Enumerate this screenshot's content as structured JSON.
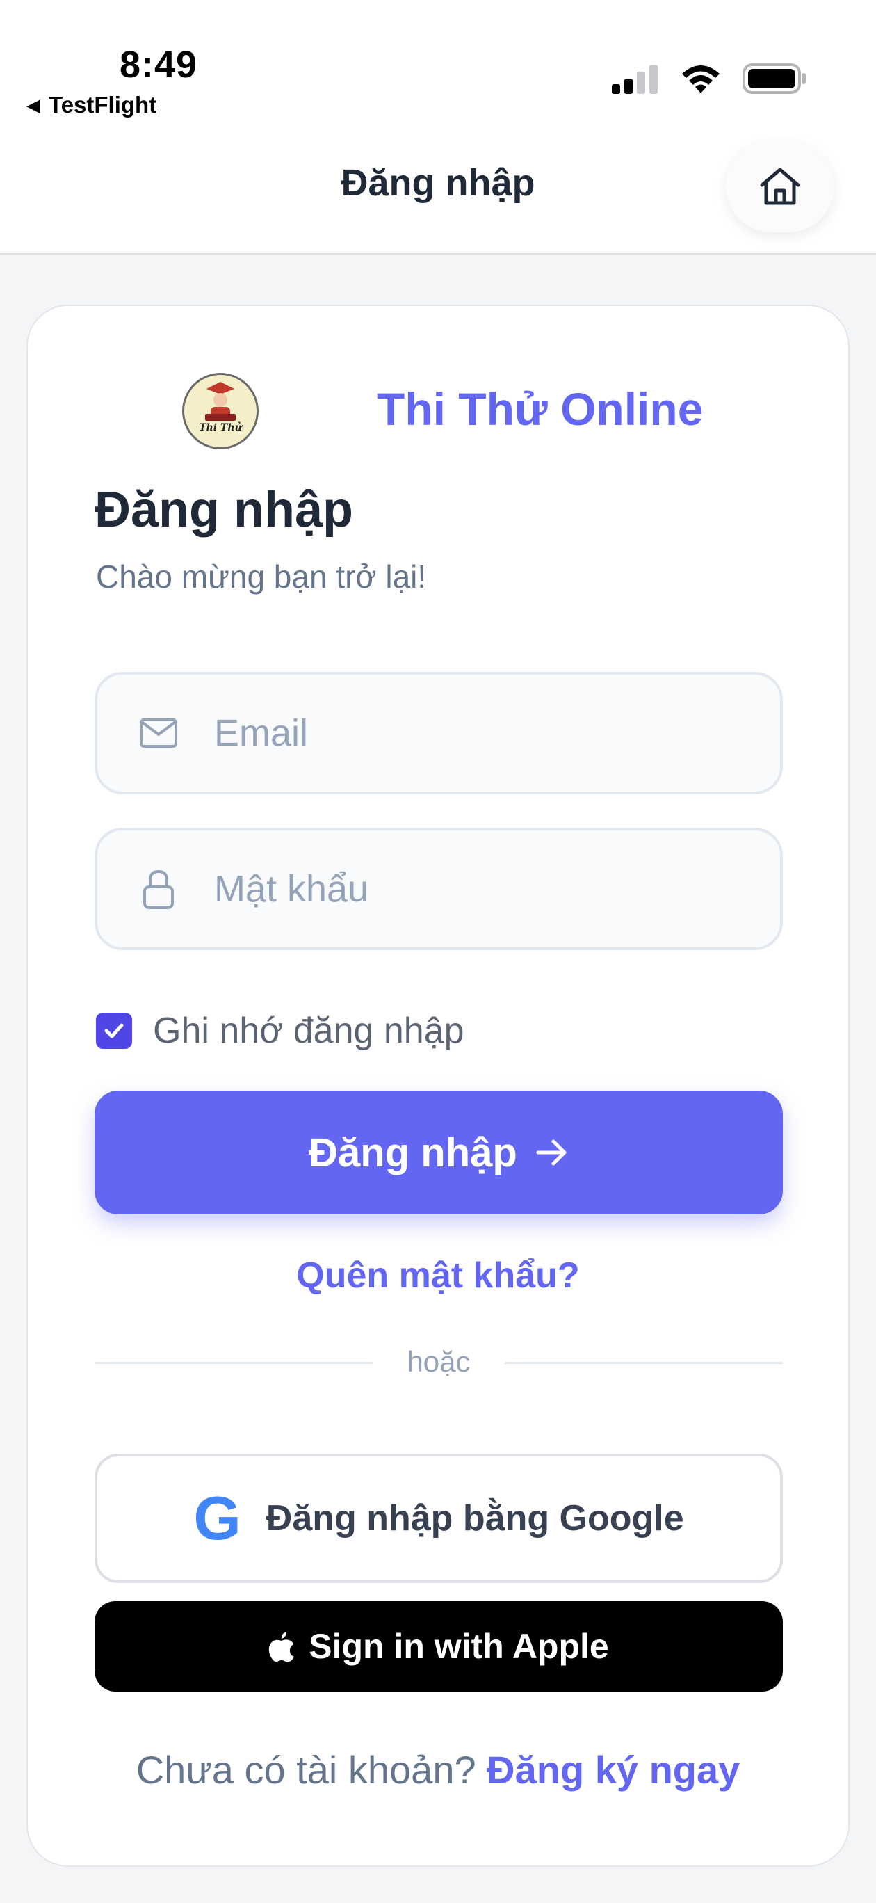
{
  "status_bar": {
    "time": "8:49",
    "back_app": "TestFlight"
  },
  "nav": {
    "title": "Đăng nhập",
    "home_icon": "home-icon"
  },
  "brand": {
    "logo_text": "Thi Thử",
    "name": "Thi Thử Online"
  },
  "login": {
    "heading": "Đăng nhập",
    "subtitle": "Chào mừng bạn trở lại!",
    "email_placeholder": "Email",
    "password_placeholder": "Mật khẩu",
    "remember_label": "Ghi nhớ đăng nhập",
    "remember_checked": true,
    "submit_label": "Đăng nhập",
    "forgot_label": "Quên mật khẩu?",
    "divider_text": "hoặc",
    "google_label": "Đăng nhập bằng Google",
    "google_glyph": "G",
    "apple_label": "Sign in with Apple",
    "signup_prompt": "Chưa có tài khoản?",
    "signup_link": "Đăng ký ngay"
  },
  "colors": {
    "accent": "#6366f1",
    "checkbox": "#4f46e5",
    "google_blue": "#4285f4"
  }
}
